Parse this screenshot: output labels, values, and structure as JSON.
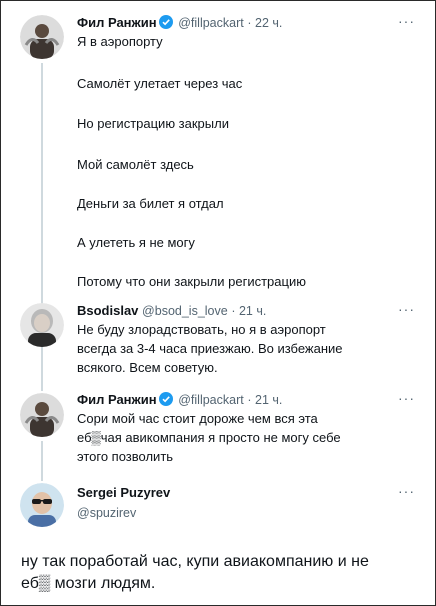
{
  "icons": {
    "more": "more-icon",
    "verified": "verified-badge-icon"
  },
  "colors": {
    "verified_blue": "#1d9bf0",
    "secondary_text": "#536471",
    "thread_line": "#cfd9de"
  },
  "tweet1": {
    "name": "Фил Ранжин",
    "handle": "@fillpackart",
    "time": "· 22 ч.",
    "more": "···",
    "lines": [
      "Я в аэропорту",
      "Самолёт улетает через час",
      "Но регистрацию закрыли",
      "Мой самолёт здесь",
      "Деньги за билет я отдал",
      "А улететь я не могу",
      "Потому что они закрыли регистрацию"
    ]
  },
  "tweet2": {
    "name": "Bsodislav",
    "handle": "@bsod_is_love",
    "time": "· 21 ч.",
    "more": "···",
    "lines": [
      "Не буду злорадствовать, но я в аэропорт",
      "всегда за 3-4 часа приезжаю. Во избежание",
      "всякого. Всем советую."
    ]
  },
  "tweet3": {
    "name": "Фил Ранжин",
    "handle": "@fillpackart",
    "time": "· 21 ч.",
    "more": "···",
    "lines": [
      "Сори мой час стоит дороже чем вся эта",
      "еб▒чая авикомпания я просто не могу себе",
      "этого позволить"
    ]
  },
  "tweet4": {
    "name": "Sergei Puzyrev",
    "handle": "@spuzirev",
    "more": "···",
    "lines": [
      "ну так поработай час, купи авиакомпанию и не",
      "еб▒ мозги людям."
    ]
  }
}
